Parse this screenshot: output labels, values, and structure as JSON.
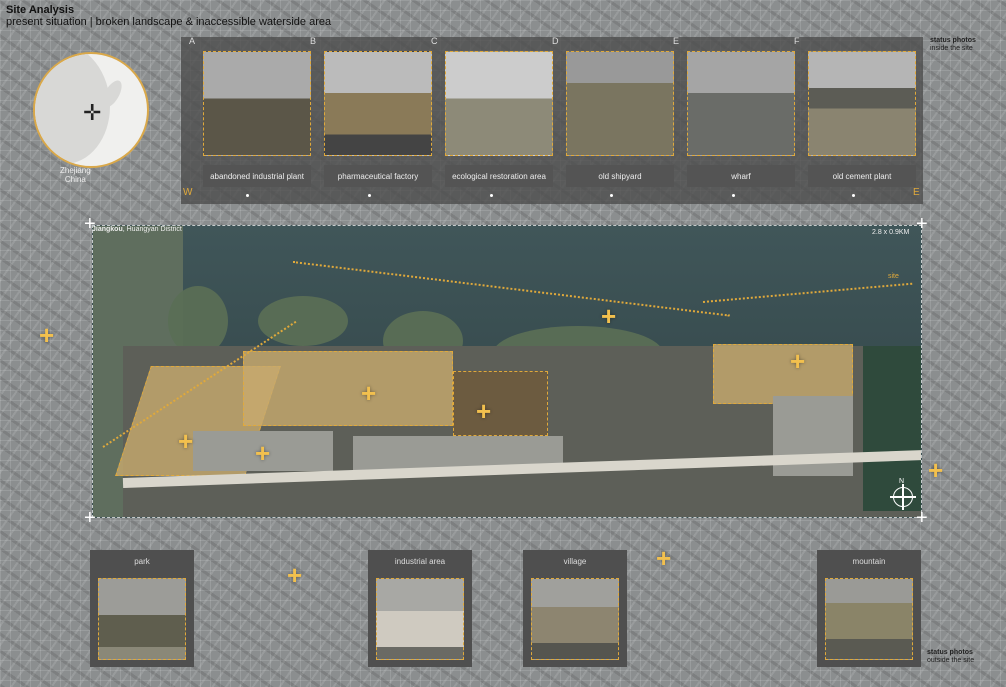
{
  "header": {
    "title": "Site Analysis",
    "subtitle": "present situation | broken landscape & inaccessible waterside area"
  },
  "location": {
    "line1": "Zhejiang",
    "line2": "China"
  },
  "status_top": {
    "title": "status photos",
    "sub": "inside the site"
  },
  "status_bottom": {
    "title": "status photos",
    "sub": "outside the site"
  },
  "direction": {
    "west": "W",
    "east": "E"
  },
  "top_photos": [
    {
      "letter": "A",
      "caption": "abandoned industrial plant",
      "tone": "#5b5648"
    },
    {
      "letter": "B",
      "caption": "pharmaceutical factory",
      "tone": "#6d6a5e"
    },
    {
      "letter": "C",
      "caption": "ecological restoration area",
      "tone": "#7a7768"
    },
    {
      "letter": "D",
      "caption": "old shipyard",
      "tone": "#6c6c60"
    },
    {
      "letter": "E",
      "caption": "wharf",
      "tone": "#636561"
    },
    {
      "letter": "F",
      "caption": "old cement plant",
      "tone": "#707068"
    }
  ],
  "site": {
    "label_bold": "Jiangkou",
    "label_rest": ", Huangyan District",
    "scale": "2.8 x 0.9KM",
    "tag": "site",
    "compass": "N"
  },
  "bottom_photos": [
    {
      "label": "park",
      "tone": "#6b6a58"
    },
    {
      "label": "industrial area",
      "tone": "#8a8880"
    },
    {
      "label": "village",
      "tone": "#7a766a"
    },
    {
      "label": "mountain",
      "tone": "#76786a"
    }
  ]
}
